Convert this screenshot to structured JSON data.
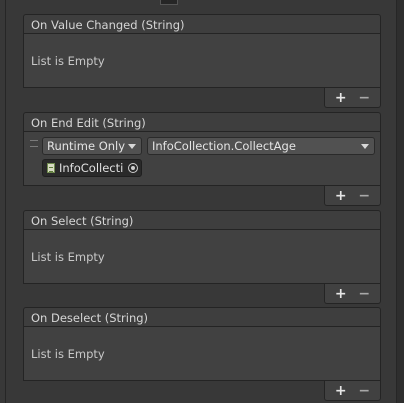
{
  "events": [
    {
      "title": "On Value Changed (String)",
      "empty_text": "List is Empty",
      "add_label": "+",
      "remove_label": "−"
    },
    {
      "title": "On End Edit (String)",
      "add_label": "+",
      "remove_label": "−",
      "entry": {
        "call_state": "Runtime Only",
        "function": "InfoCollection.CollectAge",
        "target_object": "InfoCollecti",
        "target_icon": "script-icon",
        "picker_icon": "object-picker-icon"
      }
    },
    {
      "title": "On Select (String)",
      "empty_text": "List is Empty",
      "add_label": "+",
      "remove_label": "−"
    },
    {
      "title": "On Deselect (String)",
      "empty_text": "List is Empty",
      "add_label": "+",
      "remove_label": "−"
    }
  ]
}
